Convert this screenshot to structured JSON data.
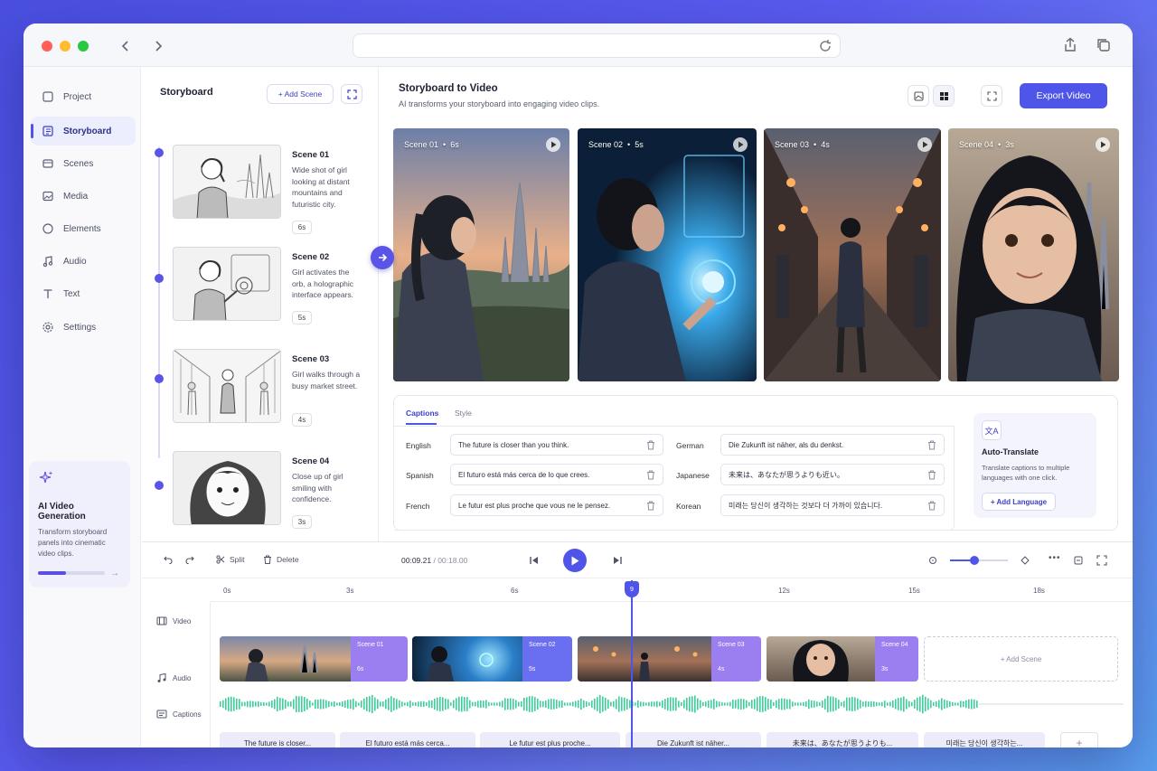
{
  "sidebar": {
    "items": [
      {
        "label": "Project",
        "icon": "home-icon"
      },
      {
        "label": "Storyboard",
        "icon": "storyboard-icon",
        "active": true
      },
      {
        "label": "Scenes",
        "icon": "layers-icon"
      },
      {
        "label": "Media",
        "icon": "image-icon"
      },
      {
        "label": "Elements",
        "icon": "circle-icon"
      },
      {
        "label": "Audio",
        "icon": "music-icon"
      },
      {
        "label": "Text",
        "icon": "text-icon"
      },
      {
        "label": "Settings",
        "icon": "gear-icon"
      }
    ],
    "ai_card": {
      "title": "AI Video Generation",
      "description": "Transform storyboard panels into cinematic video clips.",
      "progress": 0.42
    }
  },
  "storyboard": {
    "title": "Storyboard",
    "add_scene_label": "+ Add Scene",
    "scenes": [
      {
        "name": "Scene 01",
        "description": "Wide shot of girl looking at distant mountains and futuristic city.",
        "duration": "6s"
      },
      {
        "name": "Scene 02",
        "description": "Girl activates the orb, a holographic interface appears.",
        "duration": "5s"
      },
      {
        "name": "Scene 03",
        "description": "Girl walks through a busy market street.",
        "duration": "4s"
      },
      {
        "name": "Scene 04",
        "description": "Close up of girl smiling with confidence.",
        "duration": "3s"
      }
    ]
  },
  "main": {
    "title": "Storyboard to Video",
    "subtitle": "AI transforms your storyboard into engaging video clips.",
    "export_label": "Export Video",
    "videos": [
      {
        "label": "Scene 01",
        "duration": "6s"
      },
      {
        "label": "Scene 02",
        "duration": "5s"
      },
      {
        "label": "Scene 03",
        "duration": "4s"
      },
      {
        "label": "Scene 04",
        "duration": "3s"
      }
    ]
  },
  "captions": {
    "tabs": [
      "Captions",
      "Style"
    ],
    "rows": [
      {
        "lang": "English",
        "text": "The future is closer than you think."
      },
      {
        "lang": "Spanish",
        "text": "El futuro está más cerca de lo que crees."
      },
      {
        "lang": "French",
        "text": "Le futur est plus proche que vous ne le pensez."
      },
      {
        "lang": "German",
        "text": "Die Zukunft ist näher, als du denkst."
      },
      {
        "lang": "Japanese",
        "text": "未来は、あなたが思うよりも近い。"
      },
      {
        "lang": "Korean",
        "text": "미래는 당신이 생각하는 것보다 더 가까이 있습니다."
      }
    ],
    "auto_translate": {
      "title": "Auto-Translate",
      "description": "Translate captions to multiple languages with one click.",
      "add_language_label": "+ Add Language"
    }
  },
  "timeline": {
    "tools": {
      "split": "Split",
      "delete": "Delete"
    },
    "current_time": "00:09.21",
    "total_time": "/ 00:18.00",
    "playhead_label": "9",
    "ruler": [
      "0s",
      "3s",
      "6s",
      "12s",
      "15s",
      "18s"
    ],
    "tracks": {
      "video": "Video",
      "audio": "Audio",
      "captions": "Captions"
    },
    "clips": [
      {
        "label": "Scene 01",
        "duration": "6s"
      },
      {
        "label": "Scene 02",
        "duration": "5s"
      },
      {
        "label": "Scene 03",
        "duration": "4s"
      },
      {
        "label": "Scene 04",
        "duration": "3s"
      }
    ],
    "add_scene_label": "+ Add Scene",
    "caption_chips": [
      "The future is closer...",
      "El futuro está más cerca...",
      "Le futur est plus proche...",
      "Die Zukunft ist näher...",
      "未来は、あなたが思うよりも...",
      "미래는 당신이 생각하는..."
    ],
    "add_caption_label": "+"
  },
  "colors": {
    "accent": "#4f55e8",
    "clip_purple": "#8b6ff0",
    "waveform": "#3ccf9a"
  }
}
